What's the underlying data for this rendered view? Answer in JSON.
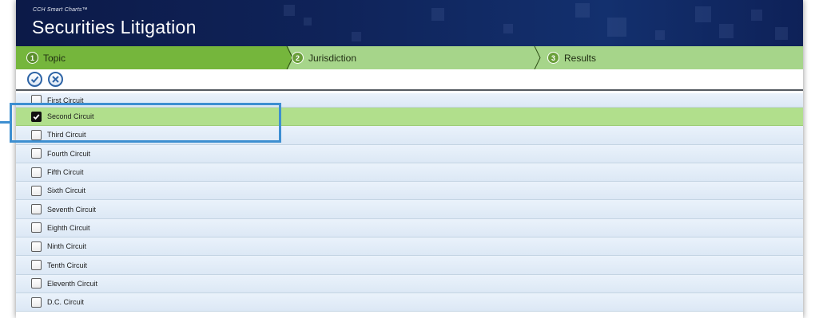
{
  "header": {
    "brand": "CCH Smart Charts™",
    "title": "Securities Litigation"
  },
  "steps": [
    {
      "number": "1",
      "label": "Topic",
      "active": true
    },
    {
      "number": "2",
      "label": "Jurisdiction",
      "active": false
    },
    {
      "number": "3",
      "label": "Results",
      "active": false
    }
  ],
  "toolbar": {
    "confirm_icon": "checkmark-circle-icon",
    "cancel_icon": "x-circle-icon"
  },
  "jurisdictions": [
    {
      "label": "First Circuit",
      "checked": false
    },
    {
      "label": "Second Circuit",
      "checked": true
    },
    {
      "label": "Third Circuit",
      "checked": false
    },
    {
      "label": "Fourth Circuit",
      "checked": false
    },
    {
      "label": "Fifth Circuit",
      "checked": false
    },
    {
      "label": "Sixth Circuit",
      "checked": false
    },
    {
      "label": "Seventh Circuit",
      "checked": false
    },
    {
      "label": "Eighth Circuit",
      "checked": false
    },
    {
      "label": "Ninth Circuit",
      "checked": false
    },
    {
      "label": "Tenth Circuit",
      "checked": false
    },
    {
      "label": "Eleventh Circuit",
      "checked": false
    },
    {
      "label": "D.C. Circuit",
      "checked": false
    }
  ],
  "colors": {
    "header_bg": "#0f2359",
    "step_active": "#75b63c",
    "step_inactive": "#a6d58a",
    "selected_row": "#b1df8c",
    "row_bg": "#e3edf8",
    "callout": "#3d8fd1"
  }
}
